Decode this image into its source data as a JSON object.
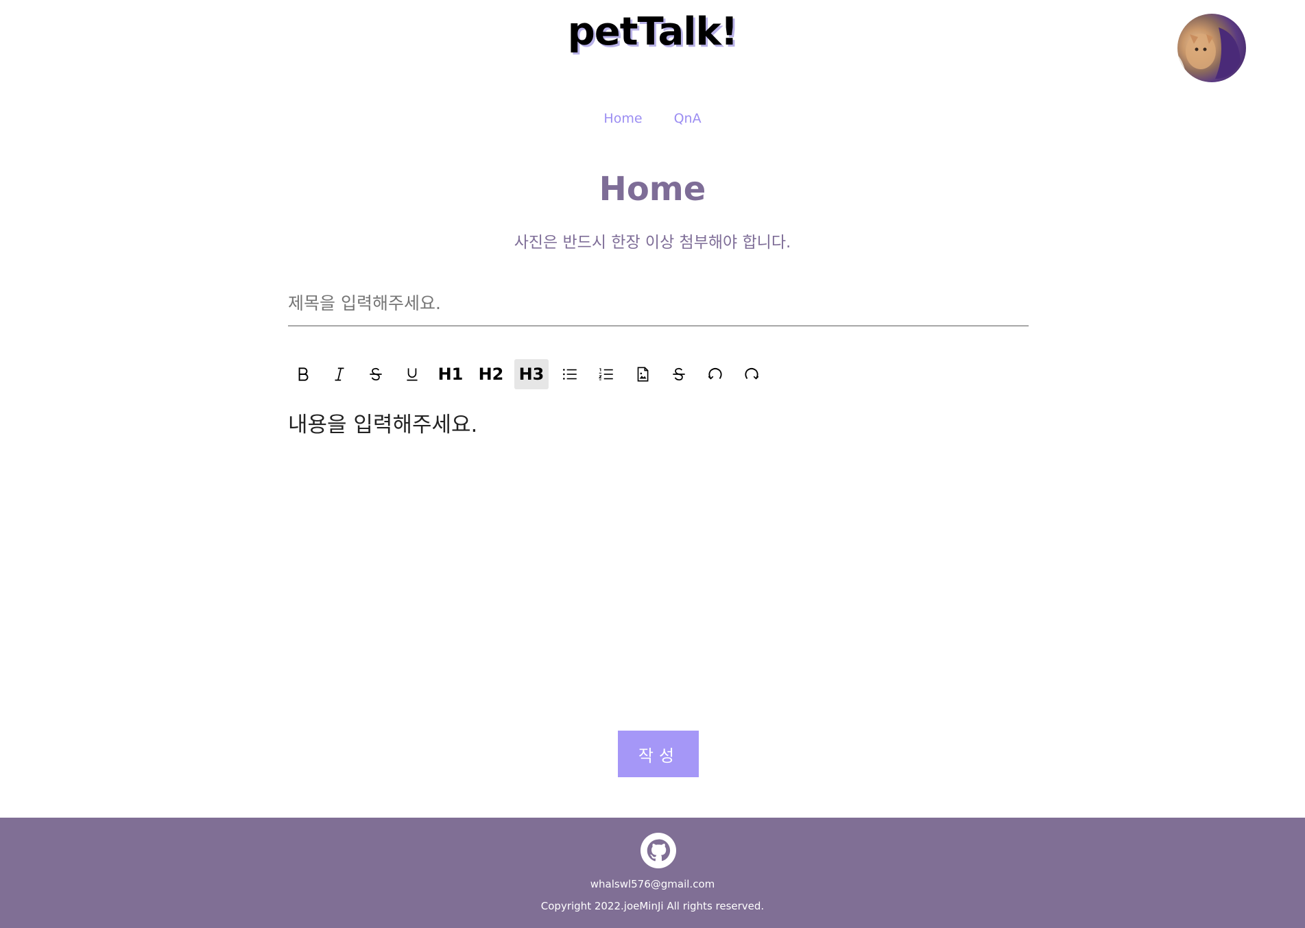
{
  "header": {
    "logo": "petTalk!",
    "avatar_alt": "profile avatar"
  },
  "nav": {
    "items": [
      {
        "label": "Home"
      },
      {
        "label": "QnA"
      }
    ]
  },
  "main": {
    "title": "Home",
    "notice": "사진은 반드시 한장 이상 첨부해야 합니다.",
    "title_input": {
      "placeholder": "제목을 입력해주세요.",
      "value": ""
    },
    "toolbar": {
      "buttons": [
        {
          "name": "bold",
          "icon": "bold-icon"
        },
        {
          "name": "italic",
          "icon": "italic-icon"
        },
        {
          "name": "strike",
          "icon": "strikethrough-icon"
        },
        {
          "name": "underline",
          "icon": "underline-icon"
        },
        {
          "name": "h1",
          "label": "H1"
        },
        {
          "name": "h2",
          "label": "H2"
        },
        {
          "name": "h3",
          "label": "H3",
          "active": true
        },
        {
          "name": "bullet-list",
          "icon": "bullet-list-icon"
        },
        {
          "name": "ordered-list",
          "icon": "ordered-list-icon"
        },
        {
          "name": "image",
          "icon": "image-file-icon"
        },
        {
          "name": "strike2",
          "icon": "strikethrough-icon"
        },
        {
          "name": "undo",
          "icon": "undo-icon"
        },
        {
          "name": "redo",
          "icon": "redo-icon"
        }
      ]
    },
    "content_placeholder": "내용을 입력해주세요.",
    "submit_label": "작성"
  },
  "footer": {
    "icon": "github-icon",
    "email": "whalswl576@gmail.com",
    "copyright": "Copyright 2022.joeMinJi All rights reserved."
  },
  "colors": {
    "accent": "#a597f7",
    "nav_link": "#9b8df2",
    "title": "#7e6d97",
    "footer_bg": "#806f95",
    "active_tool_bg": "#e6e6e6"
  }
}
